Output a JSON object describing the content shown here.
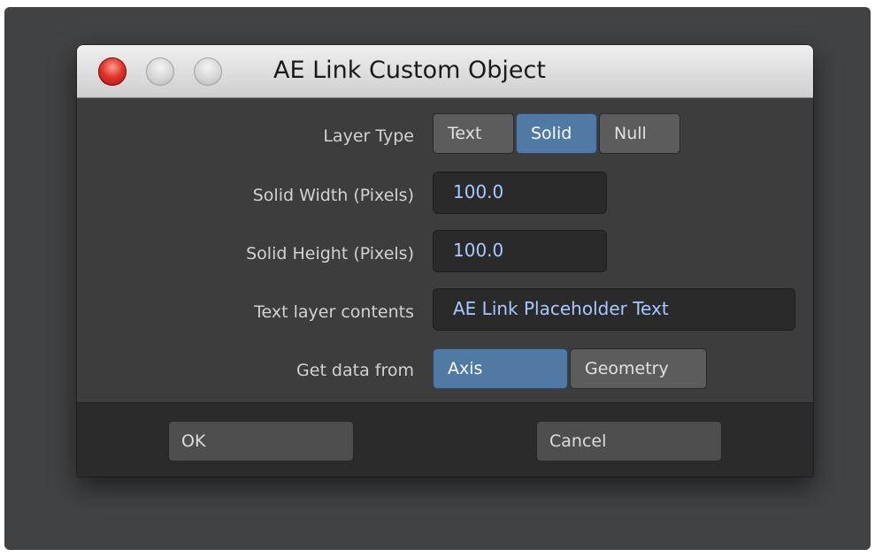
{
  "window": {
    "title": "AE Link Custom Object",
    "controls": [
      "close",
      "minimize",
      "zoom"
    ]
  },
  "form": {
    "layer_type": {
      "label": "Layer Type",
      "options": [
        "Text",
        "Solid",
        "Null"
      ],
      "selected": "Solid"
    },
    "solid_width": {
      "label": "Solid Width (Pixels)",
      "value": "100.0"
    },
    "solid_height": {
      "label": "Solid Height (Pixels)",
      "value": "100.0"
    },
    "text_contents": {
      "label": "Text layer contents",
      "value": "AE Link Placeholder Text"
    },
    "data_source": {
      "label": "Get data from",
      "options": [
        "Axis",
        "Geometry"
      ],
      "selected": "Axis"
    }
  },
  "footer": {
    "ok_label": "OK",
    "cancel_label": "Cancel"
  },
  "colors": {
    "selected_segment": "#5079a4",
    "field_text": "#a8c8ff",
    "close_button": "#e0332a"
  }
}
